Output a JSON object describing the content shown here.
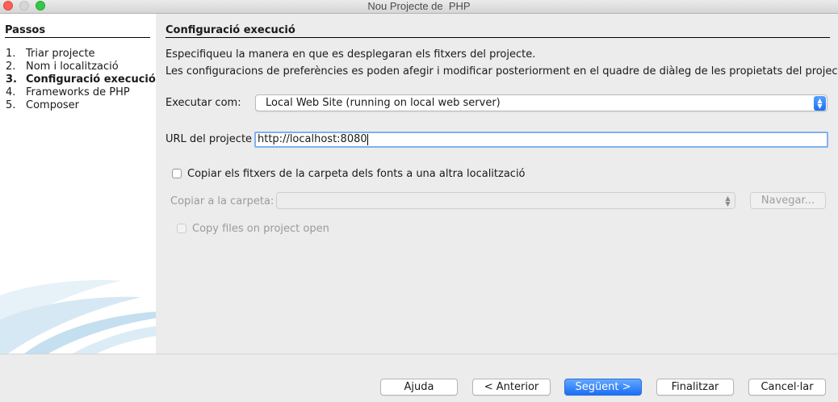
{
  "window": {
    "title": "Nou Projecte de  PHP"
  },
  "sidebar": {
    "heading": "Passos",
    "steps": [
      {
        "num": "1.",
        "label": "Triar projecte"
      },
      {
        "num": "2.",
        "label": "Nom i localització"
      },
      {
        "num": "3.",
        "label": "Configuració execució"
      },
      {
        "num": "4.",
        "label": "Frameworks de PHP"
      },
      {
        "num": "5.",
        "label": "Composer"
      }
    ],
    "current_step": 3
  },
  "panel": {
    "heading": "Configuració execució",
    "description_1": "Especifiqueu la manera en que es desplegaran els fitxers del projecte.",
    "description_2": "Les configuracions de preferències es poden afegir i modificar posteriorment en el quadre de diàleg de les propietats del projecte.",
    "run_as_label": "Executar com:",
    "run_as_value": "Local Web Site (running on local web server)",
    "url_label": "URL del projecte",
    "url_value": "http://localhost:8080",
    "copy_checkbox_label": "Copiar els fitxers de la carpeta dels fonts a una altra localització",
    "copy_checkbox_checked": false,
    "copy_to_label": "Copiar a la carpeta:",
    "copy_to_value": "",
    "browse_label": "Navegar...",
    "copy_on_open_label": "Copy files on project open",
    "copy_on_open_checked": false
  },
  "footer": {
    "help": "Ajuda",
    "back": "< Anterior",
    "next": "Següent >",
    "finish": "Finalitzar",
    "cancel": "Cancel·lar"
  },
  "colors": {
    "accent": "#1b6ff5",
    "close_button": "#fc5f57",
    "maximize_button": "#35c748",
    "focus_ring": "#7fb0f2"
  },
  "icons": [
    "close-dot",
    "minimize-dot",
    "maximize-dot",
    "updown-chevron-icon",
    "netbeans-swoosh-graphic"
  ]
}
